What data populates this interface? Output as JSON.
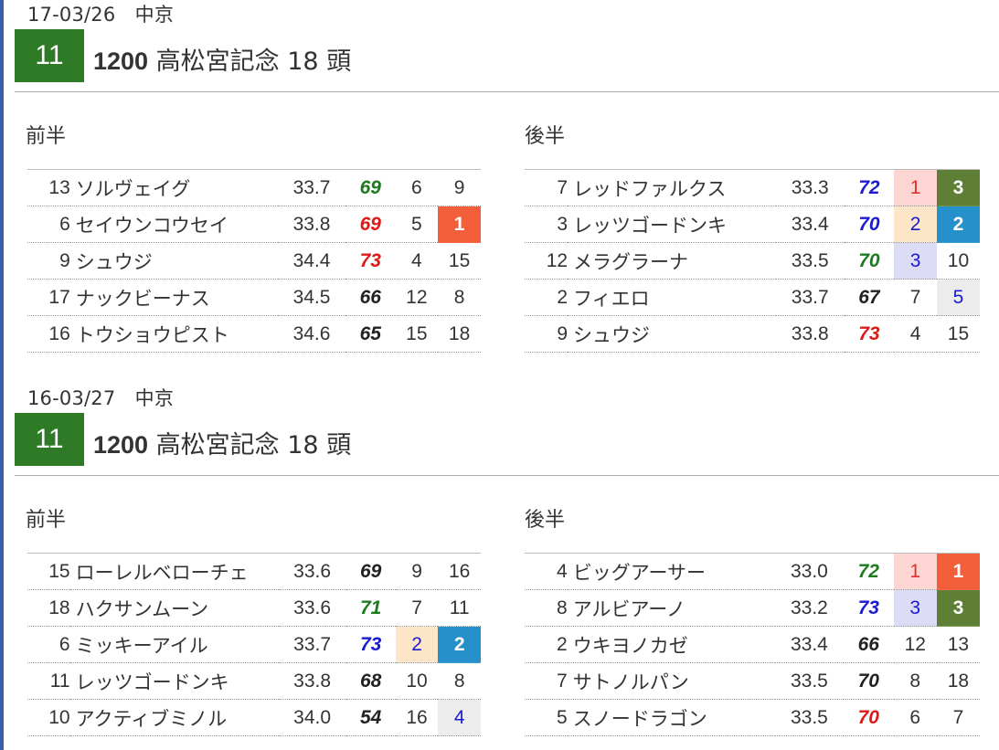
{
  "races": [
    {
      "date": "17-03/26　中京",
      "race_number": "11",
      "distance": "1200",
      "title": "高松宮記念 18 頭",
      "first_half_label": "前半",
      "second_half_label": "後半",
      "first_half": [
        {
          "horse": "13",
          "name": "ソルヴェイグ",
          "time": "33.7",
          "index": "69",
          "index_color": "green",
          "rank_a": "6",
          "rank_a_style": "",
          "rank_b": "9",
          "rank_b_style": ""
        },
        {
          "horse": "6",
          "name": "セイウンコウセイ",
          "time": "33.8",
          "index": "69",
          "index_color": "red",
          "rank_a": "5",
          "rank_a_style": "",
          "rank_b": "1",
          "rank_b_style": "red"
        },
        {
          "horse": "9",
          "name": "シュウジ",
          "time": "34.4",
          "index": "73",
          "index_color": "red",
          "rank_a": "4",
          "rank_a_style": "",
          "rank_b": "15",
          "rank_b_style": ""
        },
        {
          "horse": "17",
          "name": "ナックビーナス",
          "time": "34.5",
          "index": "66",
          "index_color": "dark",
          "rank_a": "12",
          "rank_a_style": "",
          "rank_b": "8",
          "rank_b_style": ""
        },
        {
          "horse": "16",
          "name": "トウショウピスト",
          "time": "34.6",
          "index": "65",
          "index_color": "dark",
          "rank_a": "15",
          "rank_a_style": "",
          "rank_b": "18",
          "rank_b_style": ""
        }
      ],
      "second_half": [
        {
          "horse": "7",
          "name": "レッドファルクス",
          "time": "33.3",
          "index": "72",
          "index_color": "blue",
          "rank_a": "1",
          "rank_a_style": "pink",
          "rank_b": "3",
          "rank_b_style": "olive"
        },
        {
          "horse": "3",
          "name": "レッツゴードンキ",
          "time": "33.4",
          "index": "70",
          "index_color": "blue",
          "rank_a": "2",
          "rank_a_style": "peach",
          "rank_b": "2",
          "rank_b_style": "blue"
        },
        {
          "horse": "12",
          "name": "メラグラーナ",
          "time": "33.5",
          "index": "70",
          "index_color": "green",
          "rank_a": "3",
          "rank_a_style": "lavender",
          "rank_b": "10",
          "rank_b_style": ""
        },
        {
          "horse": "2",
          "name": "フィエロ",
          "time": "33.7",
          "index": "67",
          "index_color": "dark",
          "rank_a": "7",
          "rank_a_style": "",
          "rank_b": "5",
          "rank_b_style": "gray"
        },
        {
          "horse": "9",
          "name": "シュウジ",
          "time": "33.8",
          "index": "73",
          "index_color": "red",
          "rank_a": "4",
          "rank_a_style": "",
          "rank_b": "15",
          "rank_b_style": ""
        }
      ]
    },
    {
      "date": "16-03/27　中京",
      "race_number": "11",
      "distance": "1200",
      "title": "高松宮記念 18 頭",
      "first_half_label": "前半",
      "second_half_label": "後半",
      "first_half": [
        {
          "horse": "15",
          "name": "ローレルベローチェ",
          "time": "33.6",
          "index": "69",
          "index_color": "dark",
          "rank_a": "9",
          "rank_a_style": "",
          "rank_b": "16",
          "rank_b_style": ""
        },
        {
          "horse": "18",
          "name": "ハクサンムーン",
          "time": "33.6",
          "index": "71",
          "index_color": "green",
          "rank_a": "7",
          "rank_a_style": "",
          "rank_b": "11",
          "rank_b_style": ""
        },
        {
          "horse": "6",
          "name": "ミッキーアイル",
          "time": "33.7",
          "index": "73",
          "index_color": "blue",
          "rank_a": "2",
          "rank_a_style": "peach",
          "rank_b": "2",
          "rank_b_style": "blue"
        },
        {
          "horse": "11",
          "name": "レッツゴードンキ",
          "time": "33.8",
          "index": "68",
          "index_color": "dark",
          "rank_a": "10",
          "rank_a_style": "",
          "rank_b": "8",
          "rank_b_style": ""
        },
        {
          "horse": "10",
          "name": "アクティブミノル",
          "time": "34.0",
          "index": "54",
          "index_color": "dark",
          "rank_a": "16",
          "rank_a_style": "",
          "rank_b": "4",
          "rank_b_style": "gray"
        }
      ],
      "second_half": [
        {
          "horse": "4",
          "name": "ビッグアーサー",
          "time": "33.0",
          "index": "72",
          "index_color": "green",
          "rank_a": "1",
          "rank_a_style": "pink",
          "rank_b": "1",
          "rank_b_style": "red"
        },
        {
          "horse": "8",
          "name": "アルビアーノ",
          "time": "33.2",
          "index": "73",
          "index_color": "blue",
          "rank_a": "3",
          "rank_a_style": "lavender",
          "rank_b": "3",
          "rank_b_style": "olive"
        },
        {
          "horse": "2",
          "name": "ウキヨノカゼ",
          "time": "33.4",
          "index": "66",
          "index_color": "dark",
          "rank_a": "12",
          "rank_a_style": "",
          "rank_b": "13",
          "rank_b_style": ""
        },
        {
          "horse": "7",
          "name": "サトノルパン",
          "time": "33.5",
          "index": "70",
          "index_color": "dark",
          "rank_a": "8",
          "rank_a_style": "",
          "rank_b": "18",
          "rank_b_style": ""
        },
        {
          "horse": "5",
          "name": "スノードラゴン",
          "time": "33.5",
          "index": "70",
          "index_color": "red",
          "rank_a": "6",
          "rank_a_style": "",
          "rank_b": "7",
          "rank_b_style": ""
        }
      ]
    }
  ],
  "colors": {
    "race_badge": "#2e7a26",
    "index_green": "#1e7a1e",
    "index_red": "#e01818",
    "index_blue": "#1a1ad0",
    "index_dark": "#222222",
    "rank_red_bg": "#f25f3a",
    "rank_olive_bg": "#5f7f36",
    "rank_blue_bg": "#2590c9",
    "rank_pink_bg": "#fdd5d2",
    "rank_peach_bg": "#fde6c8",
    "rank_lavender_bg": "#dcdcf6",
    "rank_gray_bg": "#ececec",
    "rank_light_red_text": "#e03030",
    "rank_light_blue_text": "#1a1ad0",
    "left_border": "#3a5fa8"
  }
}
